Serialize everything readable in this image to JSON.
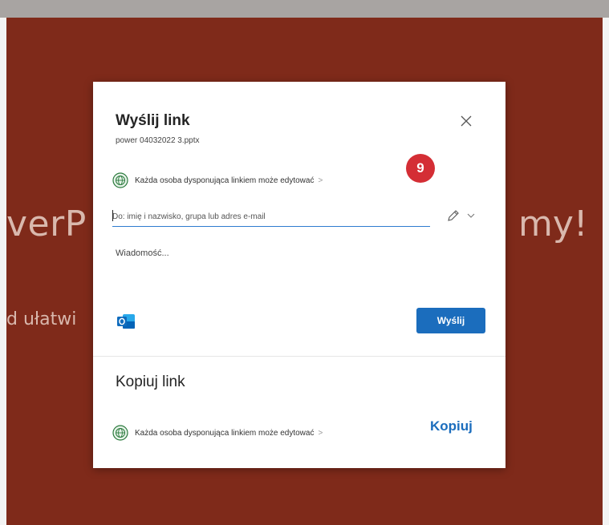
{
  "background": {
    "title_left": "verP",
    "title_right": "my!",
    "subtitle": "d ułatwi"
  },
  "dialog": {
    "title": "Wyślij link",
    "filename": "power 04032022 3.pptx",
    "permission_text": "Każda osoba dysponująca linkiem może edytować",
    "step_badge": "9",
    "to_placeholder": "Do: imię i nazwisko, grupa lub adres e-mail",
    "message_placeholder": "Wiadomość...",
    "send_label": "Wyślij",
    "copy_section_title": "Kopiuj link",
    "copy_permission_text": "Każda osoba dysponująca linkiem może edytować",
    "copy_label": "Kopiuj"
  },
  "icons": {
    "close": "close-icon",
    "globe": "globe-icon",
    "pen": "pencil-icon",
    "chevron": "chevron-down-icon",
    "outlook": "outlook-icon"
  },
  "colors": {
    "backdrop": "#7f2a1a",
    "accent": "#1b6dbd",
    "badge": "#d42e35",
    "globe": "#2a7a3c"
  }
}
